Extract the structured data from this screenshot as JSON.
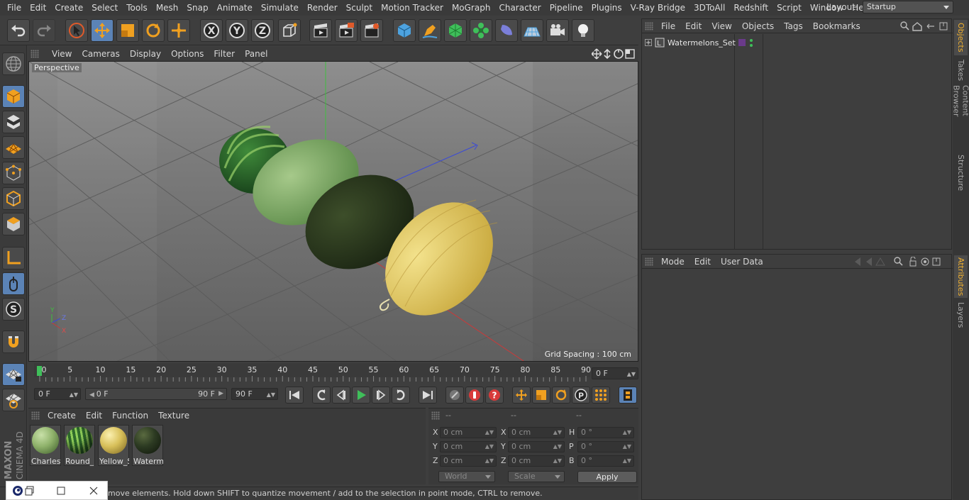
{
  "menubar": {
    "items": [
      "File",
      "Edit",
      "Create",
      "Select",
      "Tools",
      "Mesh",
      "Snap",
      "Animate",
      "Simulate",
      "Render",
      "Sculpt",
      "Motion Tracker",
      "MoGraph",
      "Character",
      "Pipeline",
      "Plugins",
      "V-Ray Bridge",
      "3DToAll",
      "Redshift",
      "Script",
      "Window",
      "Help"
    ],
    "layout_label": "Layout:",
    "layout_value": "Startup"
  },
  "viewport": {
    "menu": [
      "View",
      "Cameras",
      "Display",
      "Options",
      "Filter",
      "Panel"
    ],
    "label": "Perspective",
    "grid_spacing": "Grid Spacing : 100 cm",
    "axis_x": "X",
    "axis_y": "Y",
    "axis_z": "Z"
  },
  "timeline": {
    "ticks": [
      "0",
      "5",
      "10",
      "15",
      "20",
      "25",
      "30",
      "35",
      "40",
      "45",
      "50",
      "55",
      "60",
      "65",
      "70",
      "75",
      "80",
      "85",
      "90"
    ],
    "current_frame": "0 F"
  },
  "transport": {
    "start_field": "0 F",
    "range_start": "0 F",
    "range_end": "90 F",
    "end_field": "90 F"
  },
  "materials": {
    "menu": [
      "Create",
      "Edit",
      "Function",
      "Texture"
    ],
    "items": [
      {
        "name": "Charlest",
        "color": "#8fb26b"
      },
      {
        "name": "Round_",
        "color": "#2f6b2c"
      },
      {
        "name": "Yellow_S",
        "color": "#d8c05a"
      },
      {
        "name": "Waterm",
        "color": "#2c3a22"
      }
    ]
  },
  "coords": {
    "headers": [
      "--",
      "--",
      "--"
    ],
    "rows": [
      {
        "l1": "X",
        "v1": "0 cm",
        "l2": "X",
        "v2": "0 cm",
        "l3": "H",
        "v3": "0 °"
      },
      {
        "l1": "Y",
        "v1": "0 cm",
        "l2": "Y",
        "v2": "0 cm",
        "l3": "P",
        "v3": "0 °"
      },
      {
        "l1": "Z",
        "v1": "0 cm",
        "l2": "Z",
        "v2": "0 cm",
        "l3": "B",
        "v3": "0 °"
      }
    ],
    "space": "World",
    "mode": "Scale",
    "apply": "Apply"
  },
  "status": {
    "text": "move elements. Hold down SHIFT to quantize movement / add to the selection in point mode, CTRL to remove."
  },
  "brand": {
    "line1": "MAXON",
    "line2": "CINEMA 4D"
  },
  "objects": {
    "menu": [
      "File",
      "Edit",
      "View",
      "Objects",
      "Tags",
      "Bookmarks"
    ],
    "items": [
      {
        "name": "Watermelons_Set"
      }
    ]
  },
  "attributes": {
    "menu": [
      "Mode",
      "Edit",
      "User Data"
    ]
  },
  "right_tabs": [
    "Objects",
    "Takes",
    "Content Browser",
    "Structure",
    "Attributes",
    "Layers"
  ],
  "colors": {
    "accent": "#5b83b6",
    "active_tab": "#f0b030"
  }
}
